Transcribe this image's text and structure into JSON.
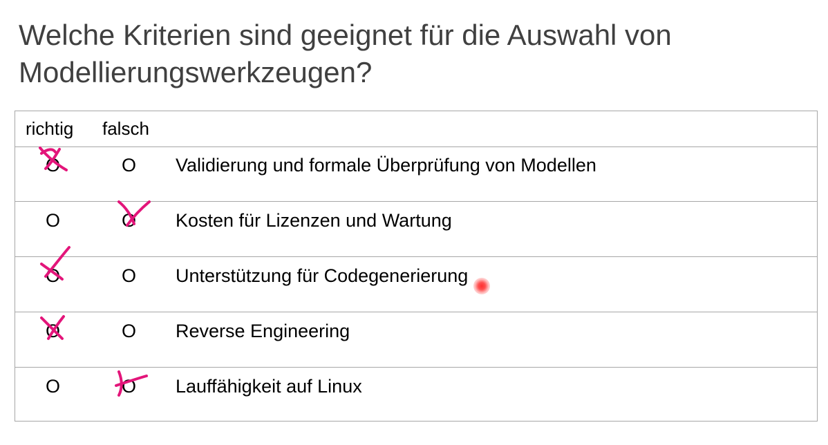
{
  "title": "Welche Kriterien sind geeignet für die Auswahl von Modellierungswerkzeugen?",
  "table": {
    "header": {
      "richtig": "richtig",
      "falsch": "falsch"
    },
    "option_glyph": "O",
    "rows": [
      {
        "label": "Validierung und formale Überprüfung von Modellen",
        "marked": "richtig"
      },
      {
        "label": "Kosten für Lizenzen und Wartung",
        "marked": "falsch"
      },
      {
        "label": "Unterstützung für Codegenerierung",
        "marked": "richtig"
      },
      {
        "label": "Reverse Engineering",
        "marked": "richtig"
      },
      {
        "label": "Lauffähigkeit auf Linux",
        "marked": "falsch"
      }
    ]
  },
  "colors": {
    "annotation": "#e3157a",
    "pointer": "#ff3030",
    "title": "#404040",
    "grid": "#a6a6a6"
  },
  "icons": {
    "mark": "pen-cross-mark-icon",
    "pointer": "laser-pointer-icon"
  }
}
